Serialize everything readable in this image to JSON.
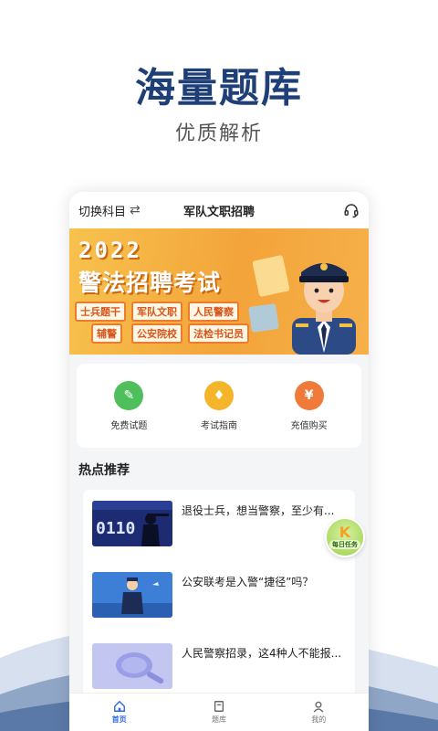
{
  "hero": {
    "title": "海量题库",
    "subtitle": "优质解析"
  },
  "topbar": {
    "subject_label": "切换科目",
    "app_title": "军队文职招聘",
    "swap_icon": "⇄"
  },
  "banner": {
    "year": "2022",
    "title": "警法招聘考试",
    "tags": [
      "士兵题干",
      "军队文职",
      "人民警察",
      "辅警",
      "公安院校",
      "法检书记员"
    ]
  },
  "actions": [
    {
      "label": "免费试题",
      "icon": "document-icon",
      "glyph": "✎",
      "color": "#4fbf5b"
    },
    {
      "label": "考试指南",
      "icon": "lightbulb-icon",
      "glyph": "♦",
      "color": "#f5b52a"
    },
    {
      "label": "充值购买",
      "icon": "moneybag-icon",
      "glyph": "¥",
      "color": "#f07a3a"
    }
  ],
  "section": {
    "title": "热点推荐"
  },
  "feed": [
    {
      "text": "退役士兵，想当警察，至少有..."
    },
    {
      "text": "公安联考是入警“捷径”吗？"
    },
    {
      "text": "人民警察招录，这4种人不能报..."
    }
  ],
  "task_badge": {
    "k": "K",
    "label": "每日任务"
  },
  "nav": [
    {
      "label": "首页",
      "icon": "home-icon",
      "active": true
    },
    {
      "label": "题库",
      "icon": "book-icon",
      "active": false
    },
    {
      "label": "我的",
      "icon": "user-icon",
      "active": false
    }
  ],
  "colors": {
    "brand": "#1f3f78",
    "accent": "#2d6be4",
    "banner": "#f3a43a"
  }
}
